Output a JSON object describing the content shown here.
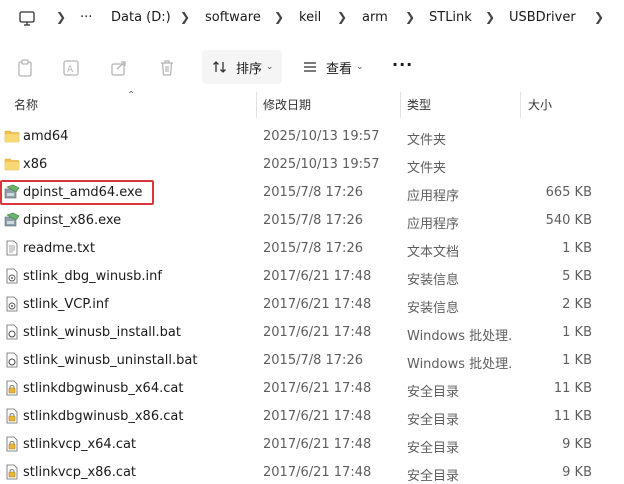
{
  "breadcrumb": [
    "Data (D:)",
    "software",
    "keil",
    "arm",
    "STLink",
    "USBDriver"
  ],
  "breadcrumb_overflow": "···",
  "toolbar": {
    "sort_label": "排序",
    "view_label": "查看",
    "more_label": "···"
  },
  "columns": {
    "name": "名称",
    "modified": "修改日期",
    "type": "类型",
    "size": "大小"
  },
  "files": [
    {
      "name": "amd64",
      "date": "2025/10/13 19:57",
      "type": "文件夹",
      "size": "",
      "icon": "folder-icon"
    },
    {
      "name": "x86",
      "date": "2025/10/13 19:57",
      "type": "文件夹",
      "size": "",
      "icon": "folder-icon"
    },
    {
      "name": "dpinst_amd64.exe",
      "date": "2015/7/8 17:26",
      "type": "应用程序",
      "size": "665 KB",
      "icon": "installer-exe-icon"
    },
    {
      "name": "dpinst_x86.exe",
      "date": "2015/7/8 17:26",
      "type": "应用程序",
      "size": "540 KB",
      "icon": "installer-exe-icon"
    },
    {
      "name": "readme.txt",
      "date": "2015/7/8 17:26",
      "type": "文本文档",
      "size": "1 KB",
      "icon": "text-file-icon"
    },
    {
      "name": "stlink_dbg_winusb.inf",
      "date": "2017/6/21 17:48",
      "type": "安装信息",
      "size": "5 KB",
      "icon": "setup-info-icon"
    },
    {
      "name": "stlink_VCP.inf",
      "date": "2017/6/21 17:48",
      "type": "安装信息",
      "size": "2 KB",
      "icon": "setup-info-icon"
    },
    {
      "name": "stlink_winusb_install.bat",
      "date": "2017/6/21 17:48",
      "type": "Windows 批处理...",
      "size": "1 KB",
      "icon": "batch-file-icon"
    },
    {
      "name": "stlink_winusb_uninstall.bat",
      "date": "2015/7/8 17:26",
      "type": "Windows 批处理...",
      "size": "1 KB",
      "icon": "batch-file-icon"
    },
    {
      "name": "stlinkdbgwinusb_x64.cat",
      "date": "2017/6/21 17:48",
      "type": "安全目录",
      "size": "11 KB",
      "icon": "security-catalog-icon"
    },
    {
      "name": "stlinkdbgwinusb_x86.cat",
      "date": "2017/6/21 17:48",
      "type": "安全目录",
      "size": "11 KB",
      "icon": "security-catalog-icon"
    },
    {
      "name": "stlinkvcp_x64.cat",
      "date": "2017/6/21 17:48",
      "type": "安全目录",
      "size": "9 KB",
      "icon": "security-catalog-icon"
    },
    {
      "name": "stlinkvcp_x86.cat",
      "date": "2017/6/21 17:48",
      "type": "安全目录",
      "size": "9 KB",
      "icon": "security-catalog-icon"
    }
  ],
  "highlighted_file": "dpinst_amd64.exe",
  "colors": {
    "folder": "#f2c14e",
    "highlight_border": "#d9363e",
    "secondary_text": "#5e5e5e"
  }
}
